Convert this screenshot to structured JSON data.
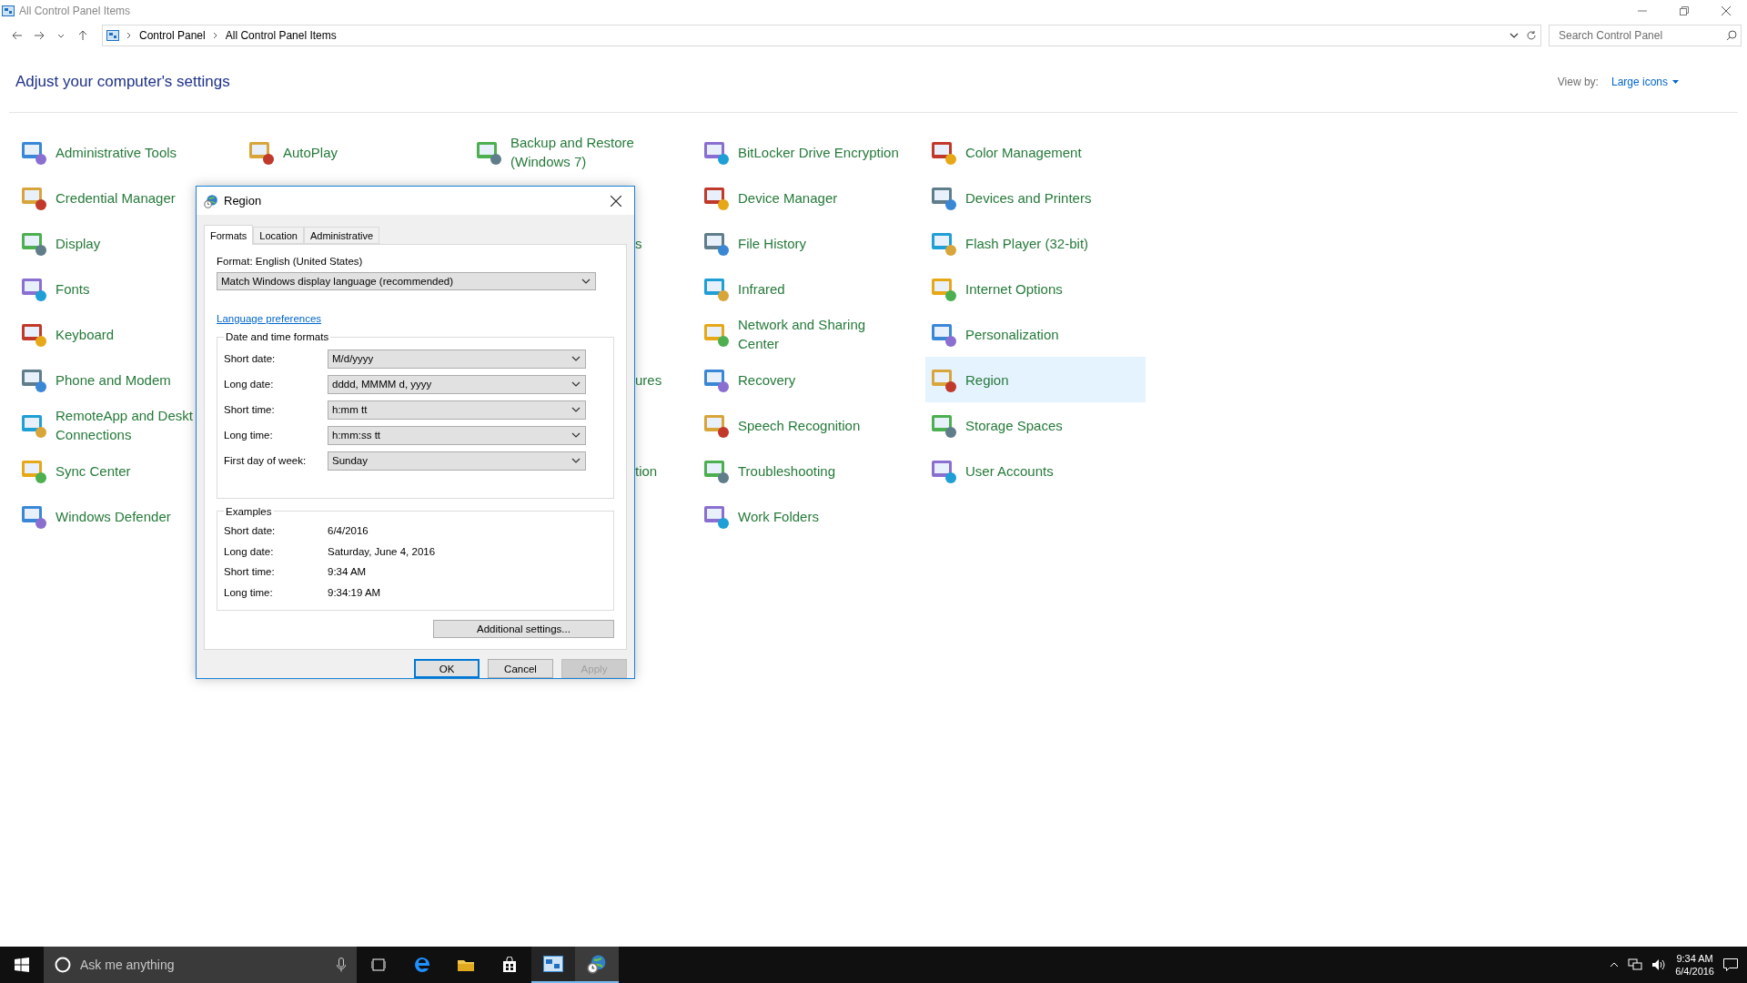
{
  "window": {
    "title": "All Control Panel Items"
  },
  "address_bar": {
    "breadcrumb": [
      "Control Panel",
      "All Control Panel Items"
    ]
  },
  "search": {
    "placeholder": "Search Control Panel"
  },
  "heading": "Adjust your computer's settings",
  "view_by": {
    "label": "View by:",
    "value": "Large icons"
  },
  "columns": [
    [
      {
        "kind": "item",
        "label": "Administrative Tools",
        "selected": false
      },
      {
        "kind": "item",
        "label": "Credential Manager",
        "selected": false
      },
      {
        "kind": "item",
        "label": "Display",
        "selected": false
      },
      {
        "kind": "item",
        "label": "Fonts",
        "selected": false
      },
      {
        "kind": "item",
        "label": "Keyboard",
        "selected": false
      },
      {
        "kind": "item",
        "label": "Phone and Modem",
        "selected": false
      },
      {
        "kind": "item",
        "label": "RemoteApp and Deskt\nConnections",
        "selected": false
      },
      {
        "kind": "item",
        "label": "Sync Center",
        "selected": false
      },
      {
        "kind": "item",
        "label": "Windows Defender",
        "selected": false
      }
    ],
    [
      {
        "kind": "item",
        "label": "AutoPlay",
        "selected": false
      }
    ],
    [
      {
        "kind": "item",
        "label": "Backup and Restore\n(Windows 7)",
        "selected": false
      },
      {
        "kind": "hidden"
      },
      {
        "kind": "fragment",
        "label": "s"
      },
      {
        "kind": "hidden"
      },
      {
        "kind": "hidden"
      },
      {
        "kind": "fragment",
        "label": "ures"
      },
      {
        "kind": "hidden"
      },
      {
        "kind": "fragment",
        "label": "tion"
      }
    ],
    [
      {
        "kind": "item",
        "label": "BitLocker Drive Encryption",
        "selected": false
      },
      {
        "kind": "item",
        "label": "Device Manager",
        "selected": false
      },
      {
        "kind": "item",
        "label": "File History",
        "selected": false
      },
      {
        "kind": "item",
        "label": "Infrared",
        "selected": false
      },
      {
        "kind": "item",
        "label": "Network and Sharing\nCenter",
        "selected": false
      },
      {
        "kind": "item",
        "label": "Recovery",
        "selected": false
      },
      {
        "kind": "item",
        "label": "Speech Recognition",
        "selected": false
      },
      {
        "kind": "item",
        "label": "Troubleshooting",
        "selected": false
      },
      {
        "kind": "item",
        "label": "Work Folders",
        "selected": false
      }
    ],
    [
      {
        "kind": "item",
        "label": "Color Management",
        "selected": false
      },
      {
        "kind": "item",
        "label": "Devices and Printers",
        "selected": false
      },
      {
        "kind": "item",
        "label": "Flash Player (32-bit)",
        "selected": false
      },
      {
        "kind": "item",
        "label": "Internet Options",
        "selected": false
      },
      {
        "kind": "item",
        "label": "Personalization",
        "selected": false
      },
      {
        "kind": "item",
        "label": "Region",
        "selected": true
      },
      {
        "kind": "item",
        "label": "Storage Spaces",
        "selected": false
      },
      {
        "kind": "item",
        "label": "User Accounts",
        "selected": false
      }
    ]
  ],
  "dialog": {
    "title": "Region",
    "tabs": [
      {
        "label": "Formats",
        "selected": true
      },
      {
        "label": "Location",
        "selected": false
      },
      {
        "label": "Administrative",
        "selected": false
      }
    ],
    "format_label": "Format: English (United States)",
    "format_value": "Match Windows display language (recommended)",
    "link": "Language preferences",
    "formats_group": {
      "title": "Date and time formats",
      "rows": [
        {
          "label": "Short date:",
          "value": "M/d/yyyy"
        },
        {
          "label": "Long date:",
          "value": "dddd, MMMM d, yyyy"
        },
        {
          "label": "Short time:",
          "value": "h:mm tt"
        },
        {
          "label": "Long time:",
          "value": "h:mm:ss tt"
        },
        {
          "label": "First day of week:",
          "value": "Sunday"
        }
      ]
    },
    "examples_group": {
      "title": "Examples",
      "rows": [
        {
          "label": "Short date:",
          "value": "6/4/2016"
        },
        {
          "label": "Long date:",
          "value": "Saturday, June 4, 2016"
        },
        {
          "label": "Short time:",
          "value": "9:34 AM"
        },
        {
          "label": "Long time:",
          "value": "9:34:19 AM"
        }
      ]
    },
    "additional_button": "Additional settings...",
    "buttons": [
      {
        "label": "OK",
        "default": true,
        "disabled": false
      },
      {
        "label": "Cancel",
        "default": false,
        "disabled": false
      },
      {
        "label": "Apply",
        "default": false,
        "disabled": true
      }
    ]
  },
  "taskbar": {
    "search_placeholder": "Ask me anything",
    "apps": [
      {
        "kind": "task-view",
        "open": false,
        "selected": false
      },
      {
        "kind": "edge",
        "open": false,
        "selected": false
      },
      {
        "kind": "explorer",
        "open": false,
        "selected": false
      },
      {
        "kind": "store",
        "open": false,
        "selected": false
      },
      {
        "kind": "control-panel",
        "open": true,
        "selected": false
      },
      {
        "kind": "region",
        "open": true,
        "selected": true
      }
    ],
    "time": "9:34 AM",
    "date": "6/4/2016"
  }
}
